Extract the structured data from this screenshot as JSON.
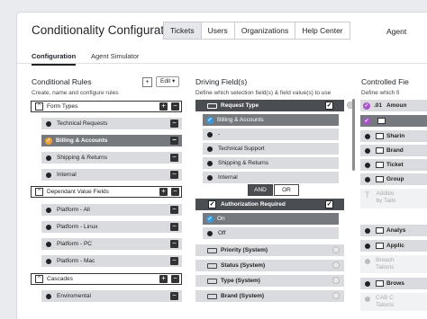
{
  "title": "Conditionality Configuration",
  "topnav": {
    "tabs": [
      "Tickets",
      "Users",
      "Organizations",
      "Help Center"
    ],
    "active": "Tickets",
    "right_label": "Agent"
  },
  "subtabs": {
    "configuration": "Configuration",
    "agent_simulator": "Agent Simulator"
  },
  "rules": {
    "heading": "Conditional Rules",
    "desc": "Create, name and configure rules",
    "add": "+",
    "edit": "Edit",
    "group1": "Form Types",
    "items1": [
      "Technical Requests",
      "Billing & Accounts",
      "Shipping & Returns",
      "Internal"
    ],
    "group2": "Dependant Value Fields",
    "items2": [
      "Platform - All",
      "Platform - Linux",
      "Platform - PC",
      "Platform - Mac"
    ],
    "group3": "Cascades",
    "items3": [
      "Enviromental"
    ]
  },
  "driving": {
    "heading": "Driving Field(s)",
    "desc": "Define which selection field(s) & field value(s) to use",
    "field1": "Request Type",
    "values1": [
      "Billing & Accounts",
      "-",
      "Technical Support",
      "Shipping & Returns",
      "Internal"
    ],
    "and": "AND",
    "or": "OR",
    "field2": "Authorization Required",
    "values2": [
      "On",
      "Off"
    ],
    "others": [
      "Priority (System)",
      "Status (System)",
      "Type (System)",
      "Brand (System)"
    ]
  },
  "controlled": {
    "heading": "Controlled Fie",
    "desc": "Define which fi",
    "items": [
      "Amoun",
      "Sharin",
      "Brand",
      "Ticket",
      "Group",
      "Additio",
      "by Tailo",
      "Analys",
      "Applic",
      "Breach",
      "Tailoris",
      "Brows",
      "CAB C",
      "Tailoris"
    ],
    "prefix": ".01"
  },
  "colors": {
    "selected": "#76797e",
    "dark": "#4a4d52",
    "orange": "#f0a030",
    "blue": "#3b9ad9",
    "purple": "#a855c9"
  }
}
